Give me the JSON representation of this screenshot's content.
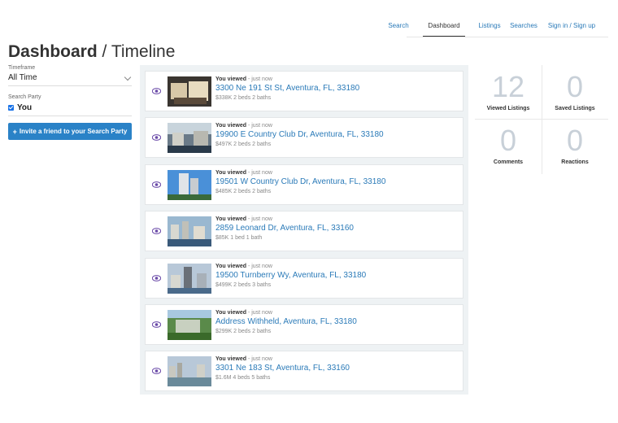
{
  "nav": {
    "items": [
      {
        "label": "Search"
      },
      {
        "label": "Dashboard"
      },
      {
        "label": "Listings"
      },
      {
        "label": "Searches"
      },
      {
        "label": "Sign in / Sign up"
      }
    ],
    "active": "Dashboard"
  },
  "title": {
    "main": "Dashboard",
    "separator": " / ",
    "sub": "Timeline"
  },
  "sidebar": {
    "timeframe_label": "Timeframe",
    "timeframe_value": "All Time",
    "party_label": "Search Party",
    "party_member": "You",
    "invite_button": "Invite a friend to your Search Party",
    "invite_icon": "+"
  },
  "timeline": {
    "entries": [
      {
        "action": "You viewed",
        "time": " - just now",
        "address": "3300 Ne 191 St St, Aventura, FL, 33180",
        "details": "$338K 2 beds 2 baths"
      },
      {
        "action": "You viewed",
        "time": " - just now",
        "address": "19900 E Country Club Dr, Aventura, FL, 33180",
        "details": "$497K 2 beds 2 baths"
      },
      {
        "action": "You viewed",
        "time": " - just now",
        "address": "19501 W Country Club Dr, Aventura, FL, 33180",
        "details": "$485K 2 beds 2 baths"
      },
      {
        "action": "You viewed",
        "time": " - just now",
        "address": "2859 Leonard Dr, Aventura, FL, 33160",
        "details": "$85K 1 bed 1 bath"
      },
      {
        "action": "You viewed",
        "time": " - just now",
        "address": "19500 Turnberry Wy, Aventura, FL, 33180",
        "details": "$499K 2 beds 3 baths"
      },
      {
        "action": "You viewed",
        "time": " - just now",
        "address": "Address Withheld, Aventura, FL, 33180",
        "details": "$299K 2 beds 2 baths"
      },
      {
        "action": "You viewed",
        "time": " - just now",
        "address": "3301 Ne 183 St, Aventura, FL, 33160",
        "details": "$1.6M 4 beds 5 baths"
      }
    ]
  },
  "stats": {
    "viewed_count": "12",
    "viewed_label": "Viewed Listings",
    "saved_count": "0",
    "saved_label": "Saved Listings",
    "comments_count": "0",
    "comments_label": "Comments",
    "reactions_count": "0",
    "reactions_label": "Reactions"
  },
  "colors": {
    "accent": "#2a82c7",
    "link": "#2a7ab8",
    "stat_number": "#c8d0d8",
    "timeline_bg": "#eef2f4"
  }
}
